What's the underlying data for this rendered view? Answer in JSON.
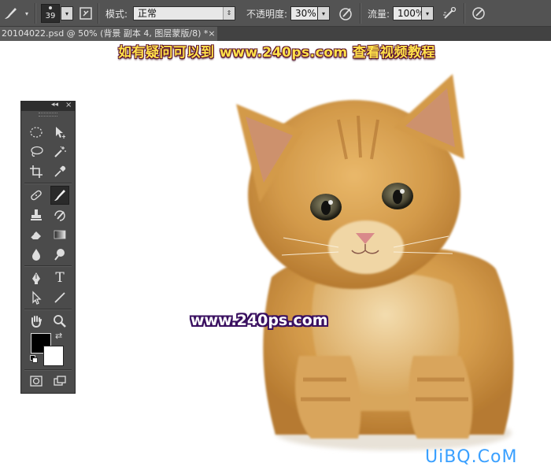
{
  "options_bar": {
    "brush_size": "39",
    "mode_label": "模式:",
    "mode_value": "正常",
    "opacity_label": "不透明度:",
    "opacity_value": "30%",
    "flow_label": "流量:",
    "flow_value": "100%"
  },
  "document_tab": {
    "title": "20104022.psd @ 50% (背景 副本 4, 图层蒙版/8) *",
    "close_glyph": "×"
  },
  "canvas": {
    "watermark_top": "如有疑问可以到 www.240ps.com 查看视频教程",
    "watermark_mid": "www.240ps.com",
    "watermark_corner": "UiBQ.CoM"
  },
  "tools_panel": {
    "collapse_glyph": "◂◂",
    "close_glyph": "×",
    "type_tool_glyph": "T",
    "selected_tool": "brush-tool"
  },
  "colors": {
    "ui_dark": "#535353",
    "panel": "#4b4b4b",
    "watermark_yellow": "#ffe14a",
    "watermark_maroon": "#5a0f2a",
    "watermark_purple": "#3a1060",
    "corner_blue": "#3aa0ff",
    "foreground": "#000000",
    "background": "#ffffff"
  }
}
